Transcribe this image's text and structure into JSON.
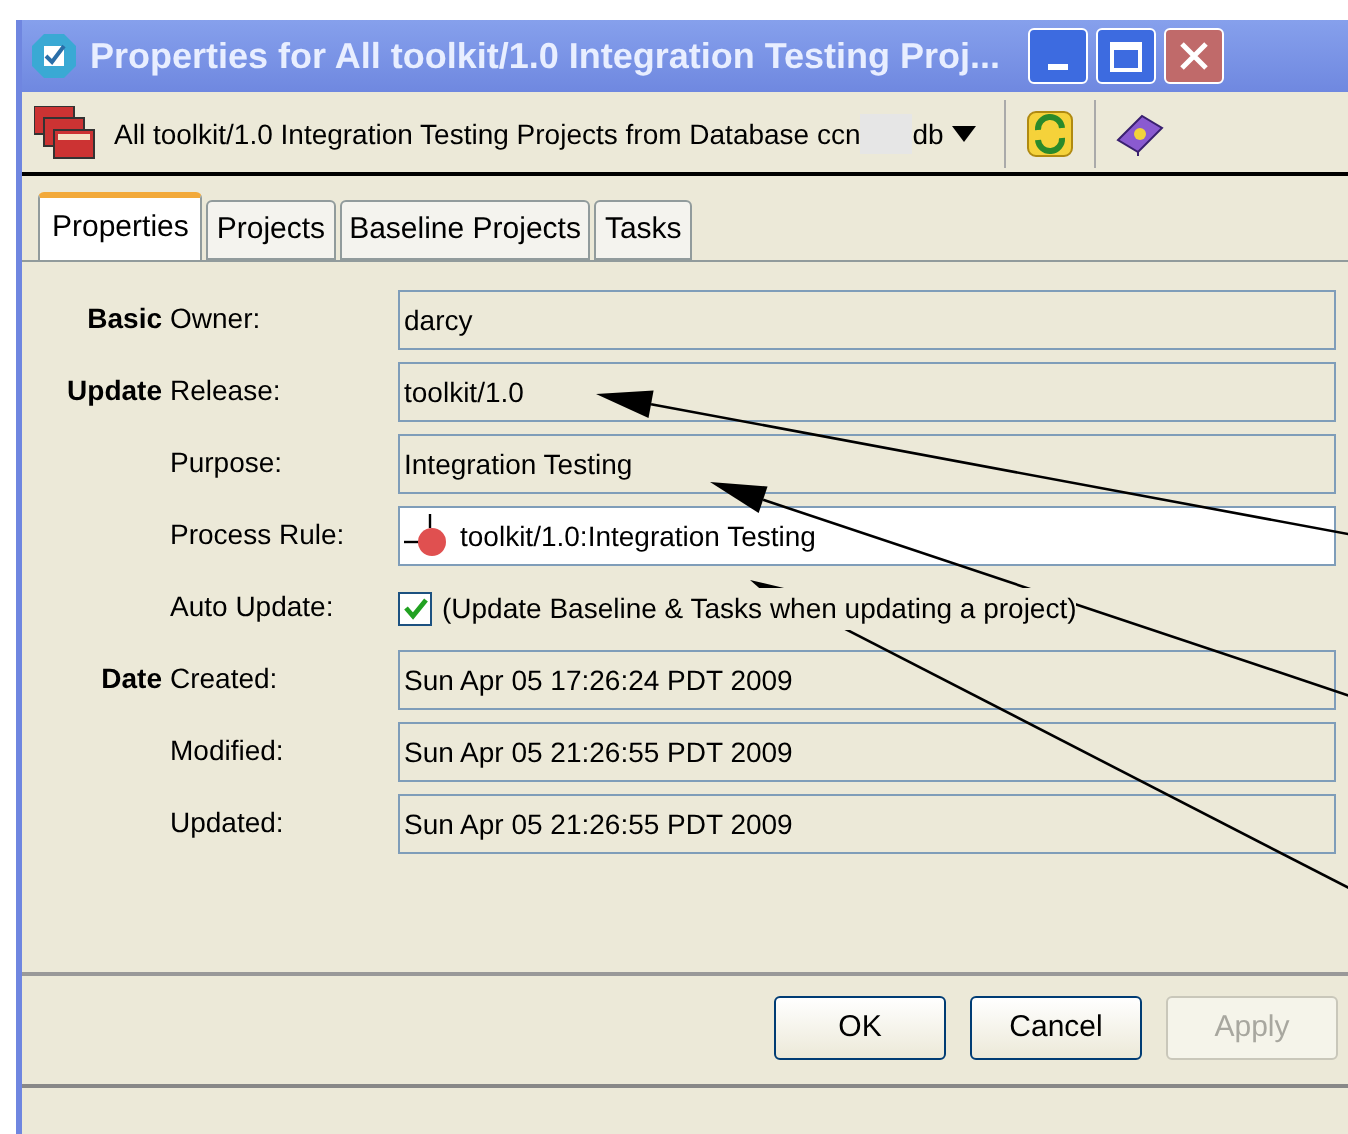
{
  "window": {
    "title": "Properties for All toolkit/1.0 Integration Testing Proj..."
  },
  "toolbar": {
    "selector": "All toolkit/1.0 Integration Testing Projects from Database ccn",
    "selector_tail": "db"
  },
  "tabs": [
    {
      "label": "Properties",
      "selected": true
    },
    {
      "label": "Projects",
      "selected": false
    },
    {
      "label": "Baseline Projects",
      "selected": false
    },
    {
      "label": "Tasks",
      "selected": false
    }
  ],
  "groups": [
    {
      "heading": "Basic",
      "fields": [
        {
          "kind": "text",
          "label": "Owner:",
          "value": "darcy"
        }
      ]
    },
    {
      "heading": "Update",
      "fields": [
        {
          "kind": "text",
          "label": "Release:",
          "value": "toolkit/1.0"
        },
        {
          "kind": "text",
          "label": "Purpose:",
          "value": "Integration Testing"
        },
        {
          "kind": "rule",
          "label": "Process Rule:",
          "value": "toolkit/1.0:Integration Testing"
        },
        {
          "kind": "checkbox",
          "label": "Auto Update:",
          "value": "(Update Baseline & Tasks when updating a project)",
          "checked": true
        }
      ]
    },
    {
      "heading": "Date",
      "fields": [
        {
          "kind": "text",
          "label": "Created:",
          "value": "Sun Apr 05 17:26:24 PDT 2009"
        },
        {
          "kind": "text",
          "label": "Modified:",
          "value": "Sun Apr 05 21:26:55 PDT 2009"
        },
        {
          "kind": "text",
          "label": "Updated:",
          "value": "Sun Apr 05 21:26:55 PDT 2009"
        }
      ]
    }
  ],
  "buttons": [
    {
      "label": "OK",
      "disabled": false
    },
    {
      "label": "Cancel",
      "disabled": false
    },
    {
      "label": "Apply",
      "disabled": true
    }
  ]
}
